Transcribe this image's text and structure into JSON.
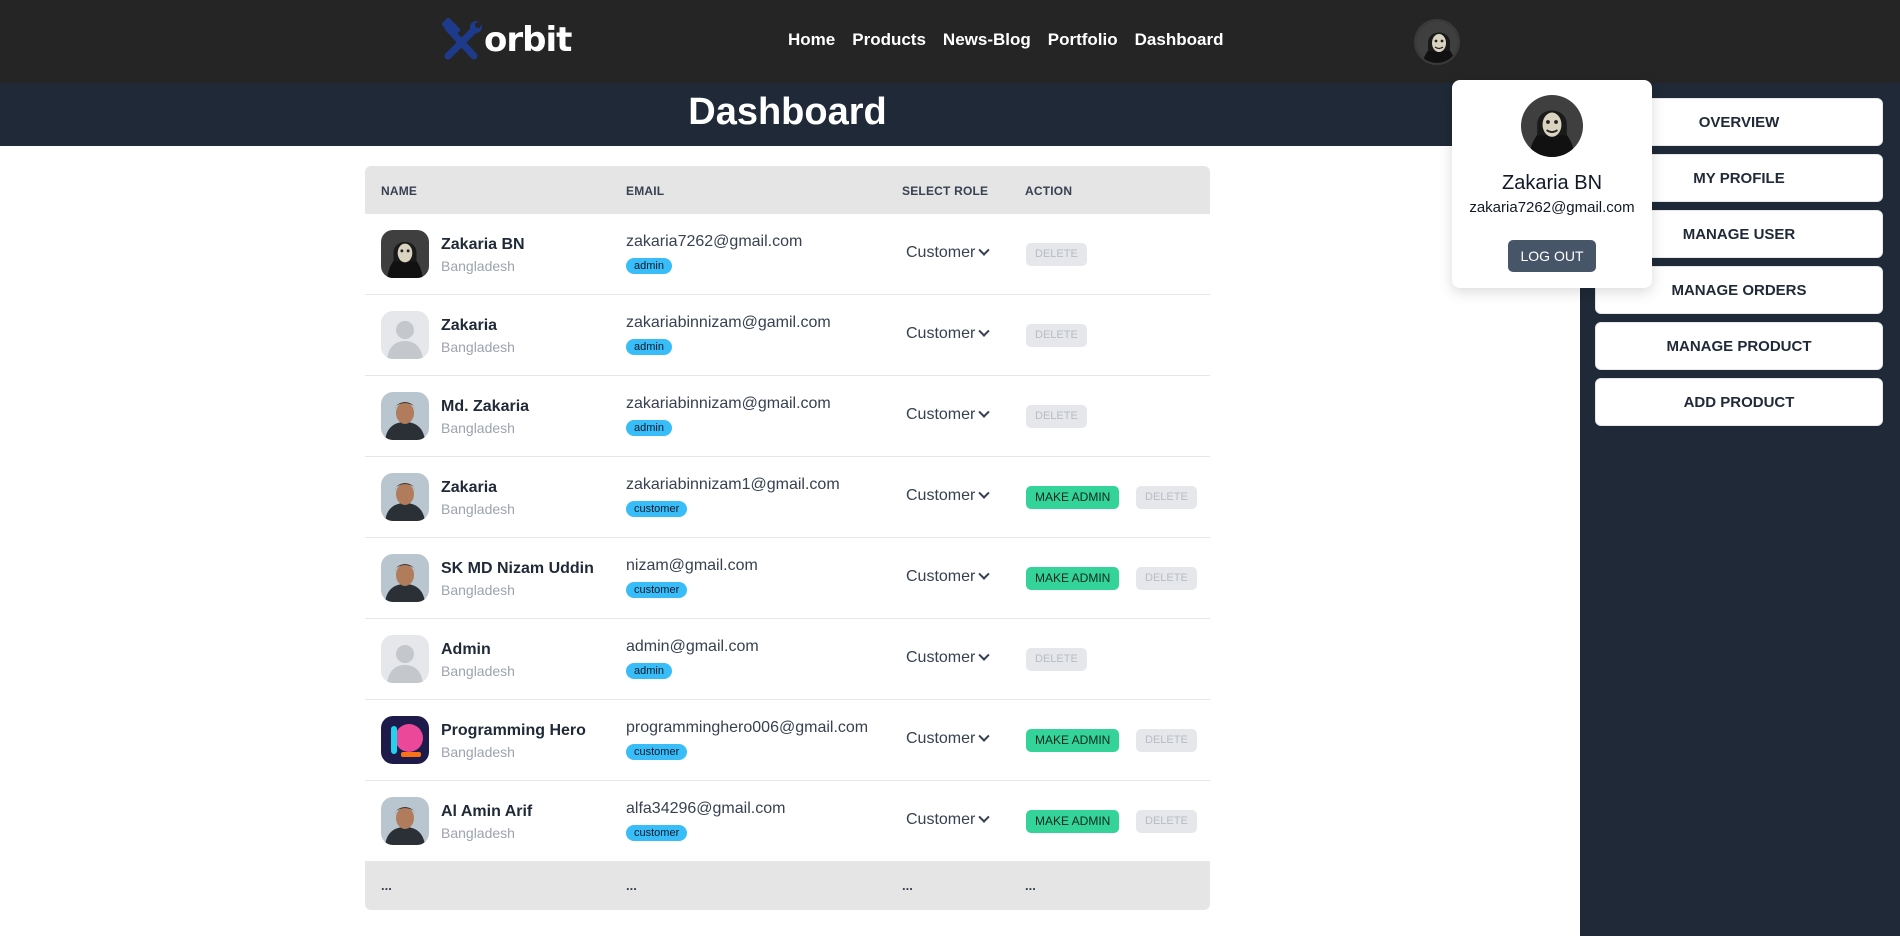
{
  "nav": {
    "logo_text": "orbit",
    "links": [
      "Home",
      "Products",
      "News-Blog",
      "Portfolio",
      "Dashboard"
    ]
  },
  "page": {
    "title": "Dashboard"
  },
  "profile": {
    "name": "Zakaria BN",
    "email": "zakaria7262@gmail.com",
    "logout_label": "LOG OUT"
  },
  "sidebar": {
    "items": [
      "OVERVIEW",
      "MY PROFILE",
      "MANAGE USER",
      "MANAGE ORDERS",
      "MANAGE PRODUCT",
      "ADD PRODUCT"
    ]
  },
  "table": {
    "headers": [
      "NAME",
      "EMAIL",
      "SELECT ROLE",
      "ACTION"
    ],
    "make_admin_label": "MAKE ADMIN",
    "delete_label": "DELETE",
    "rows": [
      {
        "name": "Zakaria BN",
        "country": "Bangladesh",
        "email": "zakaria7262@gmail.com",
        "role_badge": "admin",
        "select_role": "Customer",
        "avatar": "hacker-avatar"
      },
      {
        "name": "Zakaria",
        "country": "Bangladesh",
        "email": "zakariabinnizam@gamil.com",
        "role_badge": "admin",
        "select_role": "Customer",
        "avatar": "default-avatar"
      },
      {
        "name": "Md. Zakaria",
        "country": "Bangladesh",
        "email": "zakariabinnizam@gmail.com",
        "role_badge": "admin",
        "select_role": "Customer",
        "avatar": "photo-avatar"
      },
      {
        "name": "Zakaria",
        "country": "Bangladesh",
        "email": "zakariabinnizam1@gmail.com",
        "role_badge": "customer",
        "select_role": "Customer",
        "avatar": "photo-avatar"
      },
      {
        "name": "SK MD Nizam Uddin",
        "country": "Bangladesh",
        "email": "nizam@gmail.com",
        "role_badge": "customer",
        "select_role": "Customer",
        "avatar": "photo-avatar"
      },
      {
        "name": "Admin",
        "country": "Bangladesh",
        "email": "admin@gmail.com",
        "role_badge": "admin",
        "select_role": "Customer",
        "avatar": "default-avatar"
      },
      {
        "name": "Programming Hero",
        "country": "Bangladesh",
        "email": "programminghero006@gmail.com",
        "role_badge": "customer",
        "select_role": "Customer",
        "avatar": "brand-avatar"
      },
      {
        "name": "Al Amin Arif",
        "country": "Bangladesh",
        "email": "alfa34296@gmail.com",
        "role_badge": "customer",
        "select_role": "Customer",
        "avatar": "photo-avatar"
      }
    ],
    "footer": [
      "...",
      "...",
      "...",
      "..."
    ]
  },
  "colors": {
    "navbar": "#252525",
    "sidebar": "#1f2937",
    "badge": "#38bdf8",
    "make_admin": "#34d399"
  }
}
